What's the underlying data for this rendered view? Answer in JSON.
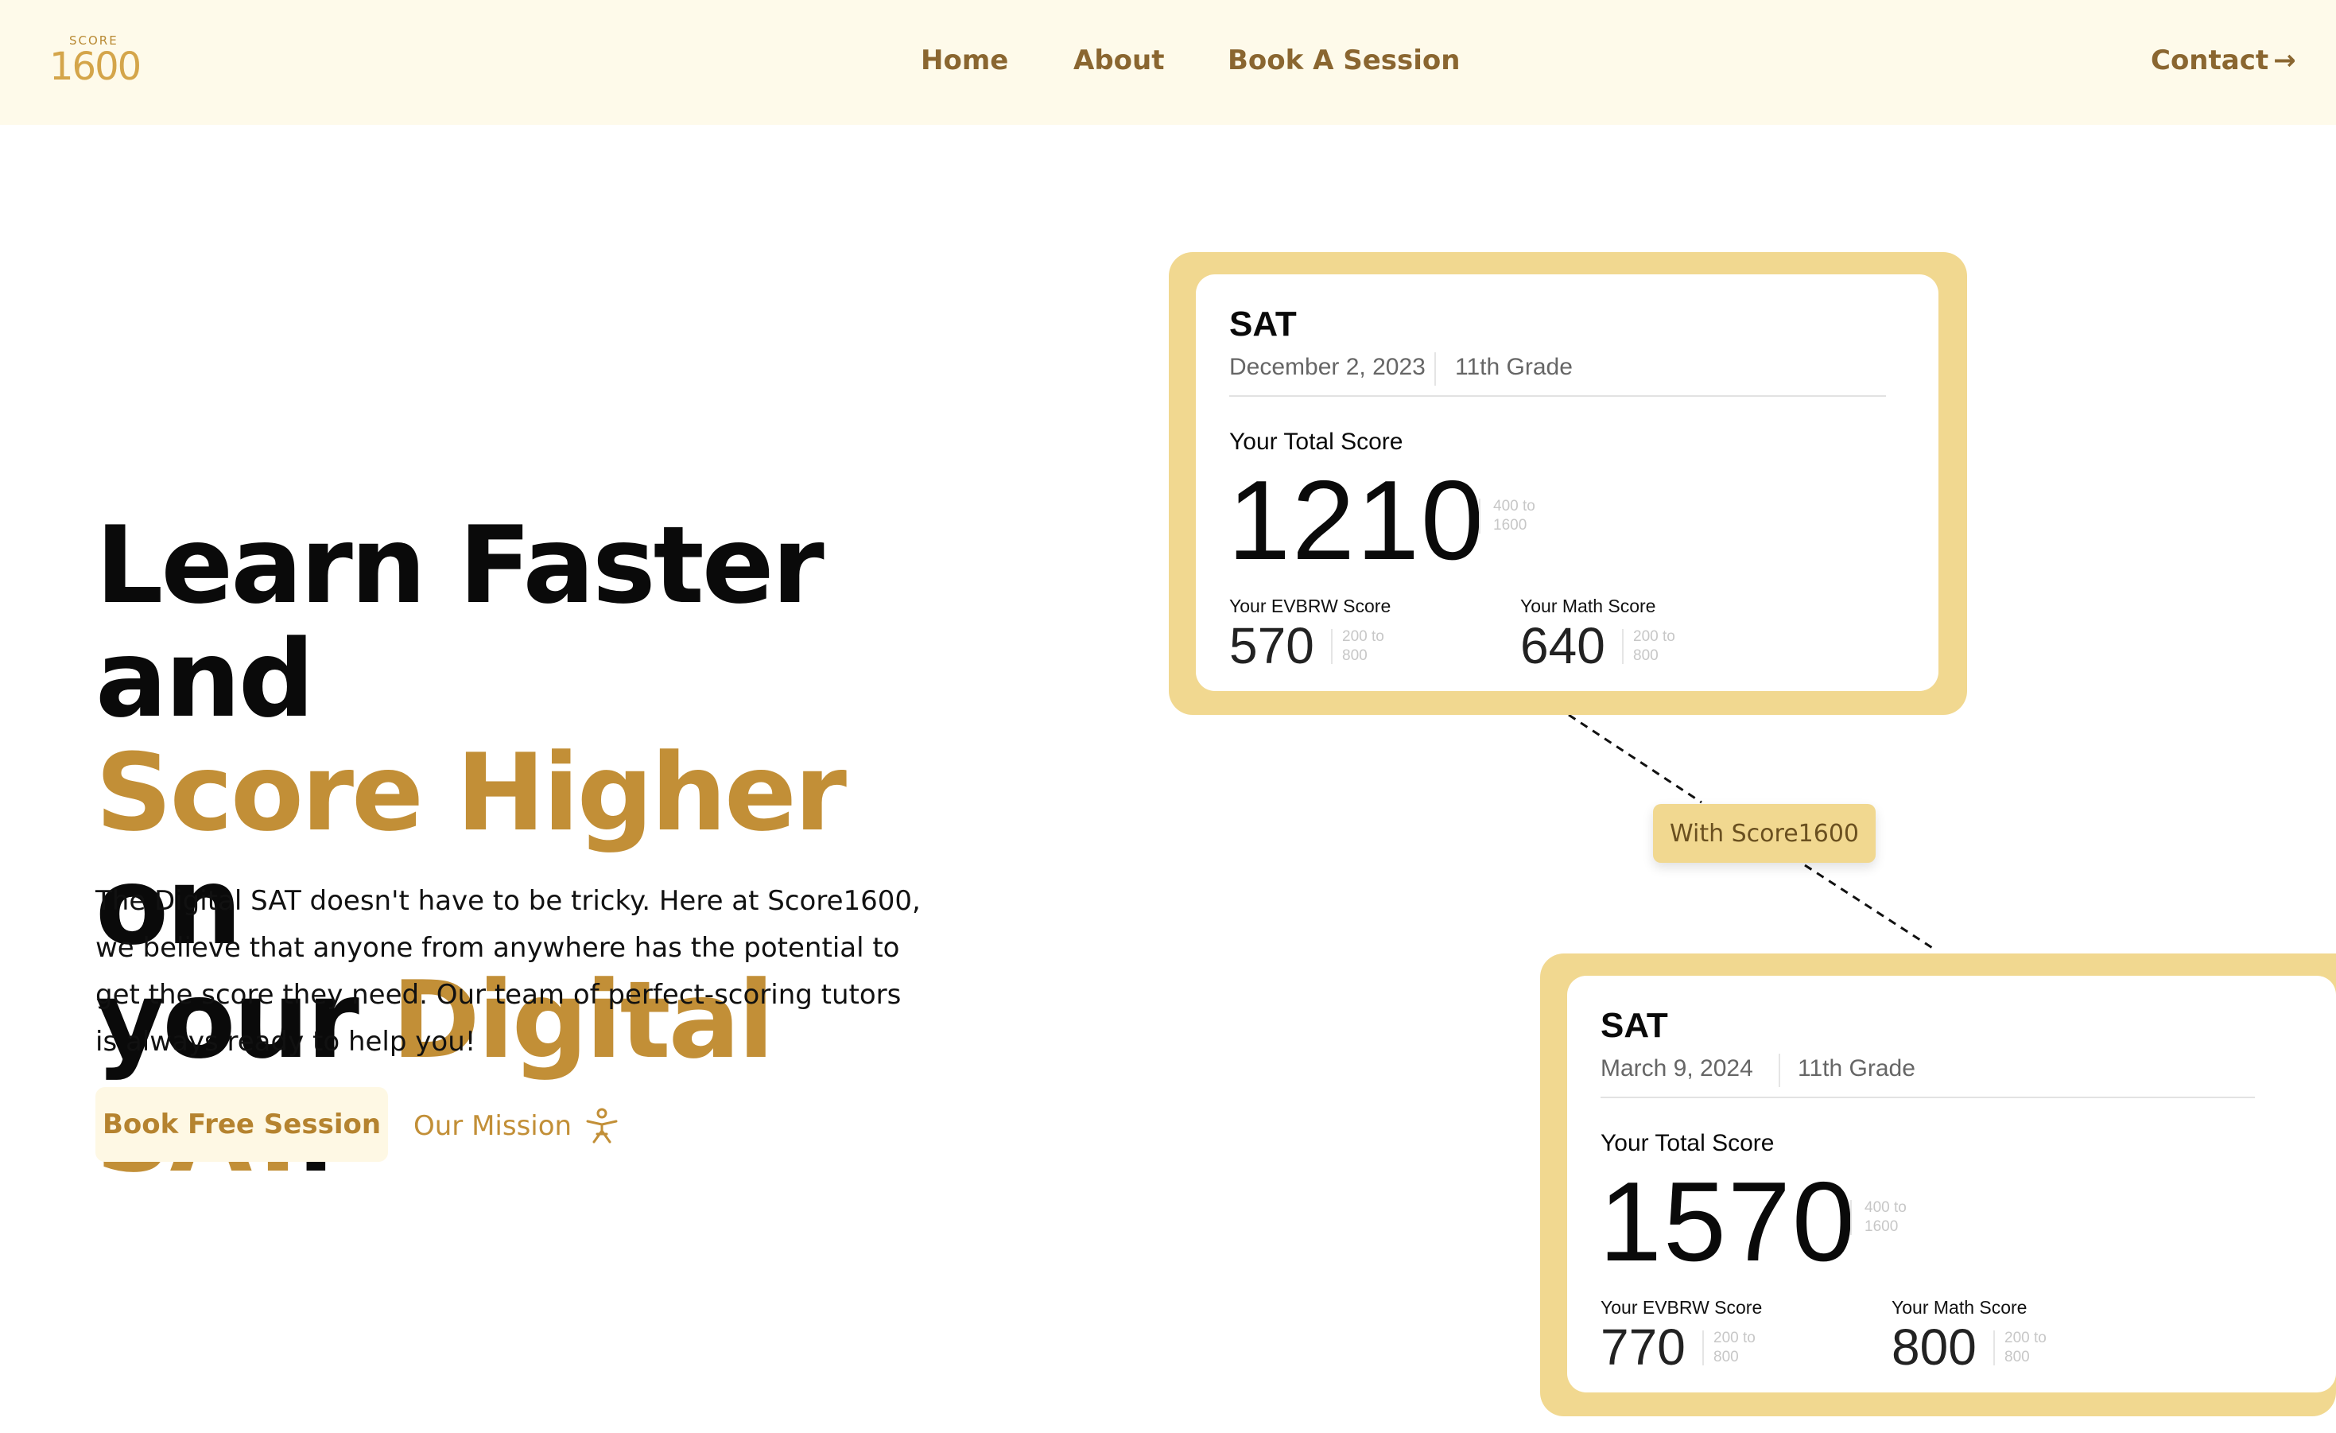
{
  "header": {
    "logo_small": "SCORE",
    "logo_big": "1600",
    "nav": {
      "home": "Home",
      "about": "About",
      "book": "Book A Session",
      "contact": "Contact",
      "contact_icon": "arrow-right-icon"
    }
  },
  "hero": {
    "line1": "Learn Faster and",
    "line2_gold": "Score Higher",
    "line2_rest": " on",
    "line3_start": "your ",
    "line3_gold": "Digital SAT",
    "line3_end": ".",
    "description": "The Digital SAT doesn't have to be tricky. Here at Score1600, we believe that anyone from anywhere has the potential to get the score they need. Our team of perfect-scoring tutors is always ready to help you!",
    "book_button": "Book Free Session",
    "mission_button": "Our Mission",
    "mission_icon": "person-star-icon"
  },
  "cards": {
    "before": {
      "title": "SAT",
      "date": "December 2, 2023",
      "grade": "11th Grade",
      "total_label": "Your Total Score",
      "total": "1210",
      "total_range_1": "400 to",
      "total_range_2": "1600",
      "evbrw_label": "Your EVBRW Score",
      "evbrw": "570",
      "math_label": "Your Math Score",
      "math": "640",
      "sub_range_1": "200 to",
      "sub_range_2": "800"
    },
    "connector_label": "With Score1600",
    "after": {
      "title": "SAT",
      "date": "March 9, 2024",
      "grade": "11th Grade",
      "total_label": "Your Total Score",
      "total": "1570",
      "total_range_1": "400 to",
      "total_range_2": "1600",
      "evbrw_label": "Your EVBRW Score",
      "evbrw": "770",
      "math_label": "Your Math Score",
      "math": "800",
      "sub_range_1": "200 to",
      "sub_range_2": "800"
    }
  },
  "colors": {
    "gold": "#c28f37",
    "card_frame": "#f1d890",
    "header_bg": "#fefaea"
  }
}
